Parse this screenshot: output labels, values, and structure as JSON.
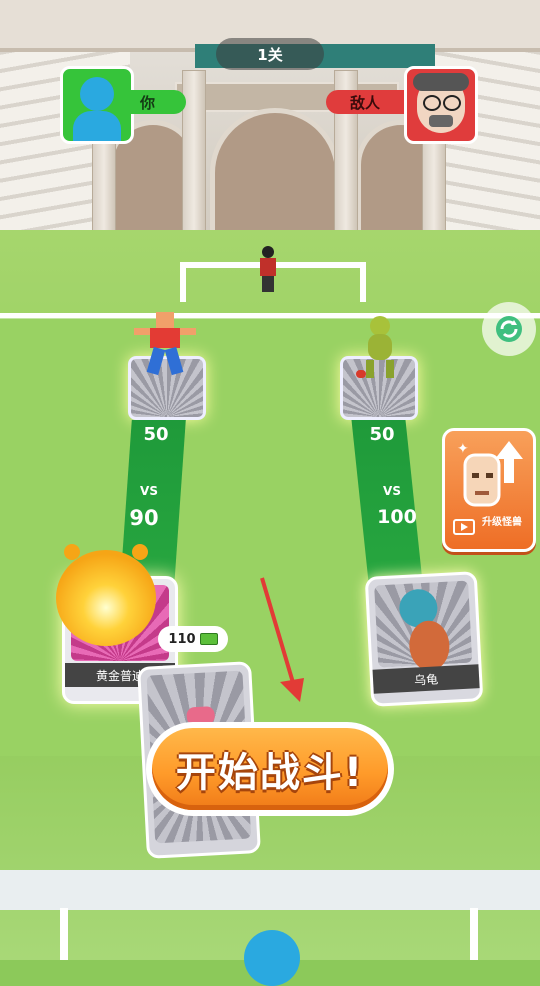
{
  "level": {
    "label": "1关"
  },
  "player": {
    "name": "你",
    "color": "#2aa9e0"
  },
  "enemy": {
    "name": "敌人",
    "color": "#e03c3c"
  },
  "lanes": [
    {
      "top_power": "50",
      "vs": "VS",
      "bottom_power": "90"
    },
    {
      "top_power": "50",
      "vs": "VS",
      "bottom_power": "100"
    }
  ],
  "cards": [
    {
      "name": "黄金普迪"
    },
    {
      "name": "乌龟"
    }
  ],
  "price_tag": {
    "amount": "110"
  },
  "upgrade": {
    "label": "升级怪兽"
  },
  "start": {
    "label": "开始战斗!"
  },
  "colors": {
    "lane_green": "#1f9a3a",
    "start_orange": "#ff9b2a",
    "upgrade_orange": "#ee6e26"
  }
}
